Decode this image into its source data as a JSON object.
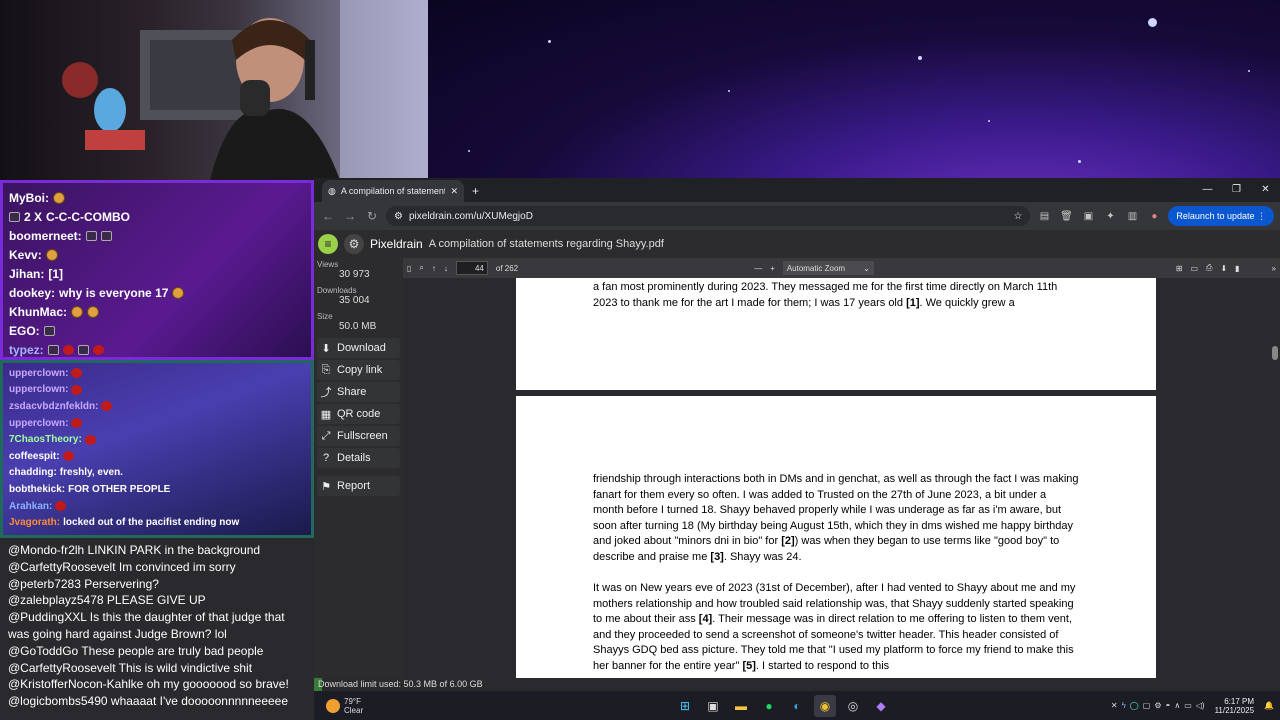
{
  "chat_top": [
    {
      "user": "MyBoi:",
      "text": "",
      "badges": [
        "emote"
      ]
    },
    {
      "user": "2 X",
      "text": "C-C-C-COMBO",
      "badges": [
        "blk"
      ]
    },
    {
      "user": "boomerneet:",
      "text": "",
      "badges": [
        "blk",
        "blk"
      ]
    },
    {
      "user": "Kevv:",
      "text": "",
      "badges": [
        "emote"
      ]
    },
    {
      "user": "Jihan:",
      "text": "[1]",
      "badges": []
    },
    {
      "user": "dookey:",
      "text": "why is everyone 17",
      "badges": [
        "emote"
      ]
    },
    {
      "user": "KhunMac:",
      "text": "",
      "badges": [
        "emote",
        "emote"
      ]
    },
    {
      "user": "EGO:",
      "text": "",
      "badges": [
        "blk"
      ]
    },
    {
      "user": "typez:",
      "text": "",
      "badges": [
        "blk",
        "red",
        "blk",
        "red"
      ]
    }
  ],
  "chat_mid": [
    {
      "user": "upperclown:",
      "color": "#c9a8ff",
      "text": ""
    },
    {
      "user": "upperclown:",
      "color": "#c9a8ff",
      "text": ""
    },
    {
      "user": "zsdacvbdznfekldn:",
      "color": "#c9a8ff",
      "text": ""
    },
    {
      "user": "upperclown:",
      "color": "#c9a8ff",
      "text": ""
    },
    {
      "user": "7ChaosTheory:",
      "color": "#9fff9f",
      "text": ""
    },
    {
      "user": "coffeespit:",
      "color": "#ffffff",
      "text": ""
    },
    {
      "user": "chadding:",
      "color": "#ffffff",
      "text": "freshly, even."
    },
    {
      "user": "bobthekick:",
      "color": "#ffffff",
      "text": "FOR OTHER PEOPLE"
    },
    {
      "user": "Arahkan:",
      "color": "#8ab4ff",
      "text": ""
    },
    {
      "user": "Jvagorath:",
      "color": "#ff8c3a",
      "text": "locked out of the pacifist ending now"
    }
  ],
  "chat_bottom": [
    {
      "user": "@Mondo-fr2lh",
      "text": "LINKIN PARK in the background"
    },
    {
      "user": "@CarfettyRoosevelt",
      "text": "Im convinced im sorry"
    },
    {
      "user": "@peterb7283",
      "text": "Perservering?"
    },
    {
      "user": "@zalebplayz5478",
      "text": "PLEASE GIVE UP"
    },
    {
      "user": "@PuddingXXL",
      "text": "Is this the daughter of that judge that was going hard against Judge Brown? lol"
    },
    {
      "user": "@GoToddGo",
      "text": "These people are truly bad people"
    },
    {
      "user": "@CarfettyRoosevelt",
      "text": "This is wild vindictive shit"
    },
    {
      "user": "@KristofferNocon-Kahlke",
      "text": "oh my gooooood so brave!"
    },
    {
      "user": "@logicbombs5490",
      "text": "whaaaat I've dooooonnnnneeeee"
    }
  ],
  "browser": {
    "tab_title": "A compilation of statements rega",
    "url": "pixeldrain.com/u/XUMegjoD",
    "relaunch": "Relaunch to update"
  },
  "pixeldrain": {
    "brand": "Pixeldrain",
    "file_title": "A compilation of statements regarding Shayy.pdf",
    "stats": [
      {
        "label": "Views",
        "value": "30 973"
      },
      {
        "label": "Downloads",
        "value": "35 004"
      },
      {
        "label": "Size",
        "value": "50.0 MB"
      }
    ],
    "buttons": [
      {
        "icon": "⬇",
        "label": "Download"
      },
      {
        "icon": "⎘",
        "label": "Copy link"
      },
      {
        "icon": "⤴",
        "label": "Share"
      },
      {
        "icon": "▦",
        "label": "QR code"
      },
      {
        "icon": "⤢",
        "label": "Fullscreen"
      },
      {
        "icon": "?",
        "label": "Details"
      },
      {
        "icon": "⚑",
        "label": "Report"
      }
    ],
    "download_limit": "Download limit used: 50.3 MB of 6.00 GB",
    "download_used_fraction": 0.008
  },
  "pdf": {
    "page_number": "44",
    "page_total": "of 262",
    "zoom": "Automatic Zoom",
    "page1_lines": [
      "a fan most prominently during 2023. They messaged me for the first time directly on March 11th",
      "2023 to thank me for the art I made for them; I was 17 years old [1]. We quickly grew a"
    ],
    "page2_para1": "friendship through interactions both in DMs and in genchat, as well as through the fact I was making fanart for them every so often. I was added to Trusted on the 27th of June 2023, a bit under a month before I turned 18. Shayy behaved properly while I was underage as far as i'm aware, but soon after turning 18 (My birthday being August 15th, which they in dms wished me happy birthday and joked about \"minors dni in bio\" for [2]) was when they began to use terms like \"good boy\" to describe and praise me [3]. Shayy was 24.",
    "page2_para2": "It was on New years eve of 2023 (31st of December), after I had vented to Shayy about me and my mothers relationship and how troubled said relationship was, that Shayy suddenly started speaking to me about their ass [4]. Their message was in direct relation to me offering to listen to them vent, and they proceeded to send a screenshot of someone's twitter header. This header consisted of Shayys GDQ bed ass picture. They told me that \"I used my platform to force my friend to make this her banner for the entire year\" [5]. I started to respond to this"
  },
  "taskbar": {
    "temp": "79°F",
    "condition": "Clear",
    "time": "6:17 PM",
    "date": "11/21/2025"
  }
}
